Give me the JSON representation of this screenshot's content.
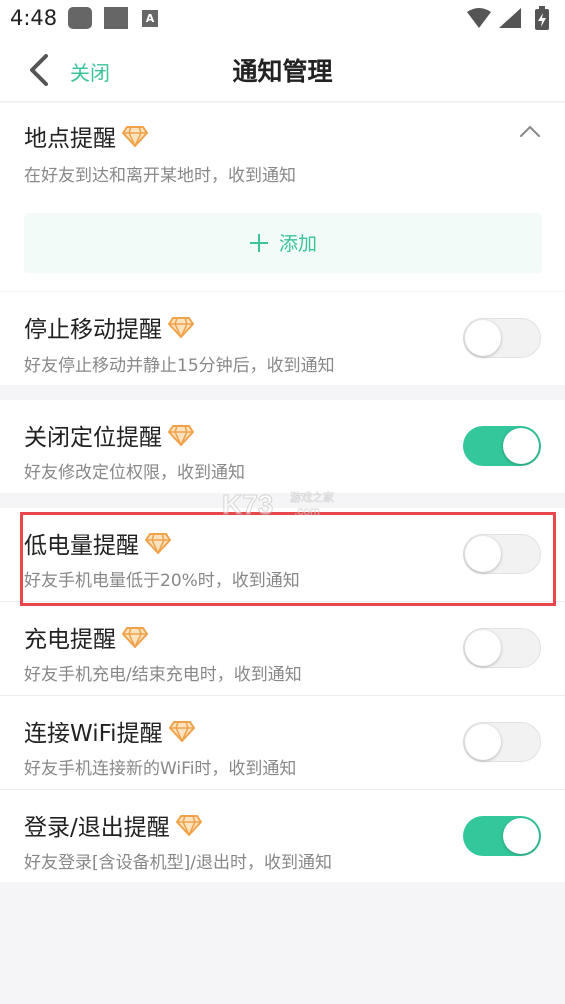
{
  "status_bar": {
    "time": "4:48",
    "badge_letter": "A"
  },
  "nav": {
    "close_label": "关闭",
    "title": "通知管理"
  },
  "location_reminder": {
    "title": "地点提醒",
    "desc": "在好友到达和离开某地时，收到通知",
    "add_label": "添加",
    "expanded": true
  },
  "items": [
    {
      "title": "停止移动提醒",
      "desc": "好友停止移动并静止15分钟后，收到通知",
      "enabled": false
    },
    {
      "title": "关闭定位提醒",
      "desc": "好友修改定位权限，收到通知",
      "enabled": true
    },
    {
      "title": "低电量提醒",
      "desc": "好友手机电量低于20%时，收到通知",
      "enabled": false,
      "highlighted": true
    },
    {
      "title": "充电提醒",
      "desc": "好友手机充电/结束充电时，收到通知",
      "enabled": false
    },
    {
      "title": "连接WiFi提醒",
      "desc": "好友手机连接新的WiFi时，收到通知",
      "enabled": false
    },
    {
      "title": "登录/退出提醒",
      "desc": "好友登录[含设备机型]/退出时，收到通知",
      "enabled": true
    }
  ],
  "watermark": {
    "text": "K73",
    "subtext": "游戏之家",
    "domain": ".com"
  },
  "colors": {
    "accent": "#33c79b",
    "highlight": "#e8474c",
    "gem": "#f0a24a"
  },
  "icons": [
    "back-chevron-icon",
    "chevron-up-icon",
    "plus-icon",
    "gem-icon",
    "wifi-icon",
    "signal-icon",
    "battery-icon"
  ]
}
